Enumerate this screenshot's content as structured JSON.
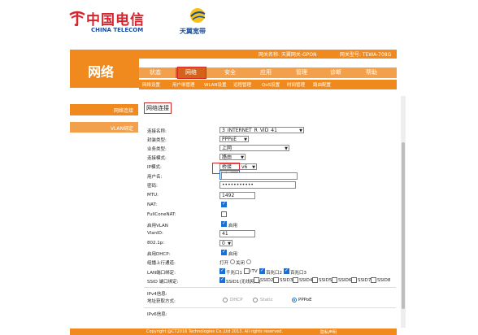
{
  "brand": {
    "logo_cn": "中国电信",
    "logo_en": "CHINA TELECOM",
    "sub_logo": "天翼宽带"
  },
  "infobar": {
    "gateway_name": "网关名称: 天翼网关-GPON",
    "gateway_model": "网关型号: TEWA-708G"
  },
  "title": "网络",
  "nav": [
    {
      "label": "状态"
    },
    {
      "label": "网络"
    },
    {
      "label": "安全"
    },
    {
      "label": "应用"
    },
    {
      "label": "管理"
    },
    {
      "label": "诊断"
    },
    {
      "label": "帮助"
    }
  ],
  "subnav": [
    {
      "label": "网络设置"
    },
    {
      "label": "用户绑管理"
    },
    {
      "label": "WLAN设置"
    },
    {
      "label": "远程管理"
    },
    {
      "label": "QoS设置"
    },
    {
      "label": "时间管理"
    },
    {
      "label": "路由配置"
    }
  ],
  "sidebar": [
    {
      "label": "网络连接"
    },
    {
      "label": "VLAN绑定"
    }
  ],
  "page_title": "网络连接",
  "form": {
    "conn_name_label": "连接名称:",
    "conn_name_value": "3_INTERNET_R_VID_41",
    "encap_label": "封装类型:",
    "encap_value": "PPPoE",
    "service_label": "业务类型:",
    "service_value": "上网",
    "conn_mode_label": "连接模式:",
    "conn_mode_value": "路由",
    "ip_mode_label": "IP模式:",
    "ip_mode_value": "桥接",
    "ip_mode_suffix": "v6",
    "dropdown_option": "路由",
    "username_label": "用户名:",
    "username_value": "",
    "password_label": "密码:",
    "password_value": "•••••••••••",
    "mtu_label": "MTU:",
    "mtu_value": "1492",
    "nat_label": "NAT:",
    "fullcone_label": "FullConeNAT:",
    "vlan_enable_label": "启用VLAN",
    "vlan_enable_text": "启用",
    "vlanid_label": "VlanID:",
    "vlanid_value": "41",
    "dot1p_label": "802.1p:",
    "dot1p_value": "0",
    "dhcp_label": "启用DHCP:",
    "dhcp_text": "启用",
    "multicast_label": "组播上行通道:",
    "multicast_on": "打开",
    "multicast_off": "关闭",
    "lan_bind_label": "LAN端口绑定:",
    "lan_ports": [
      {
        "label": "千兆口1",
        "checked": true
      },
      {
        "label": "iTV",
        "checked": false
      },
      {
        "label": "百兆口2",
        "checked": true
      },
      {
        "label": "百兆口3",
        "checked": true
      }
    ],
    "ssid_bind_label": "SSID 端口绑定:",
    "ssids": [
      {
        "label": "SSID1(无线网络)",
        "checked": true
      },
      {
        "label": "SSID2",
        "checked": false
      },
      {
        "label": "SSID3",
        "checked": false
      },
      {
        "label": "SSID4",
        "checked": false
      },
      {
        "label": "SSID5",
        "checked": false
      },
      {
        "label": "SSID6",
        "checked": false
      },
      {
        "label": "SSID7",
        "checked": false
      },
      {
        "label": "SSID8",
        "checked": false
      }
    ],
    "ipv4_info_label": "IPv4信息:",
    "addr_mode_label": "地址获取方式:",
    "addr_modes": [
      {
        "label": "DHCP",
        "checked": false
      },
      {
        "label": "Static",
        "checked": false
      },
      {
        "label": "PPPoE",
        "checked": true
      }
    ],
    "ipv6_info_label": "IPv6信息:"
  },
  "footer": {
    "copyright": "Copyright @CT2016 Technologies Co.,Ltd 2013. All rights reserved.",
    "right": "隐私声明"
  },
  "colors": {
    "orange": "#f08a1e",
    "light_orange": "#f3a04c",
    "dark_orange": "#d5621a",
    "highlight_red": "#d42828",
    "check_blue": "#1a6fd4"
  }
}
